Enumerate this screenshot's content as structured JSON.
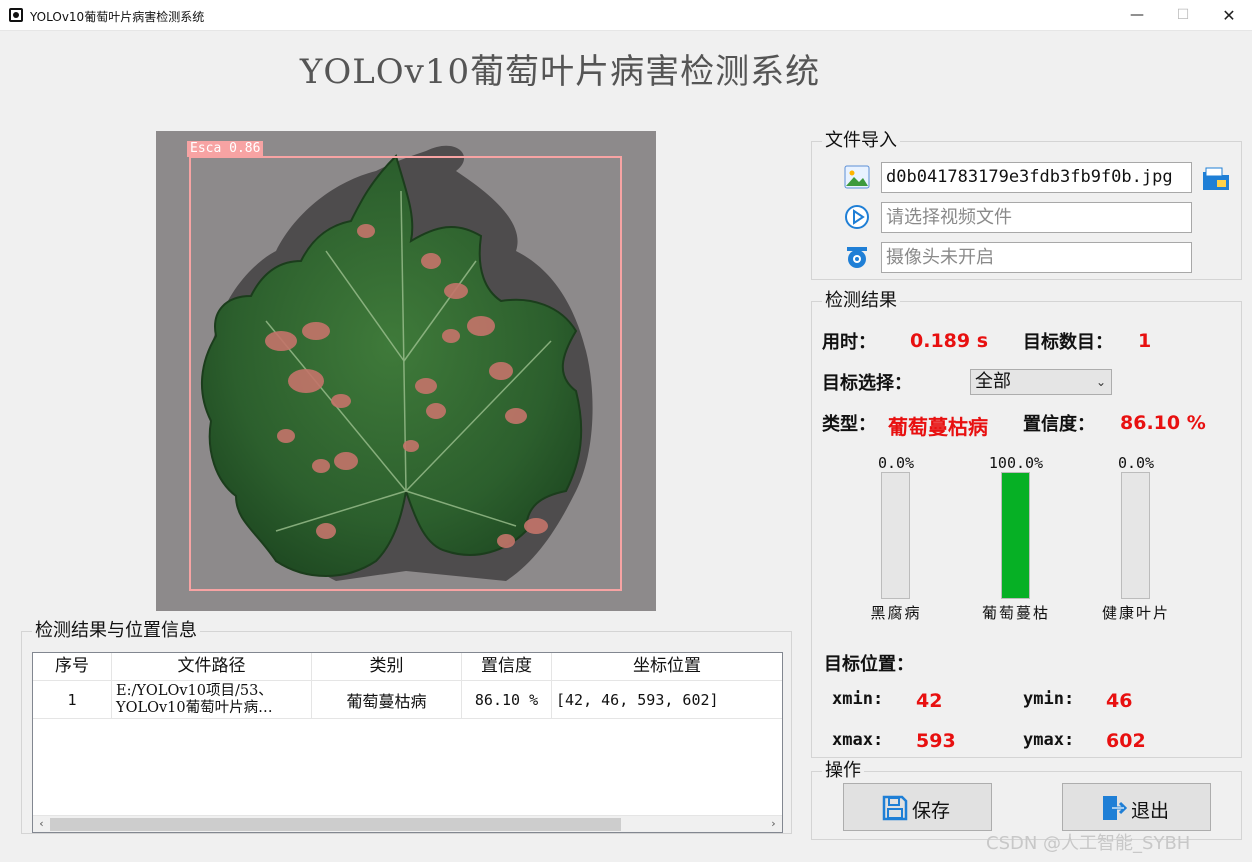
{
  "window": {
    "title": "YOLOv10葡萄叶片病害检测系统",
    "min": "—",
    "max": "☐",
    "close": "✕"
  },
  "app_title": "YOLOv10葡萄叶片病害检测系统",
  "detection_image": {
    "box_label": "Esca 0.86"
  },
  "file_import": {
    "title": "文件导入",
    "image_file": "d0b041783179e3fdb3fb9f0b.jpg",
    "video_placeholder": "请选择视频文件",
    "camera_status": "摄像头未开启"
  },
  "result": {
    "title": "检测结果",
    "time_label": "用时：",
    "time_value": "0.189 s",
    "count_label": "目标数目：",
    "count_value": "1",
    "select_label": "目标选择：",
    "select_value": "全部",
    "type_label": "类型：",
    "type_value": "葡萄蔓枯病",
    "conf_label": "置信度：",
    "conf_value": "86.10 %",
    "bars": [
      {
        "name": "黑腐病",
        "pct_text": "0.0%",
        "fraction": 0.0
      },
      {
        "name": "葡萄蔓枯",
        "pct_text": "100.0%",
        "fraction": 1.0
      },
      {
        "name": "健康叶片",
        "pct_text": "0.0%",
        "fraction": 0.0
      }
    ],
    "pos_title": "目标位置：",
    "xmin_label": "xmin:",
    "xmin": "42",
    "ymin_label": "ymin:",
    "ymin": "46",
    "xmax_label": "xmax:",
    "xmax": "593",
    "ymax_label": "ymax:",
    "ymax": "602"
  },
  "ops": {
    "title": "操作",
    "save": "保存",
    "exit": "退出"
  },
  "table": {
    "title": "检测结果与位置信息",
    "headers": [
      "序号",
      "文件路径",
      "类别",
      "置信度",
      "坐标位置"
    ],
    "rows": [
      {
        "idx": "1",
        "path_line1": "E:/YOLOv10项目/53、",
        "path_line2": "YOLOv10葡萄叶片病…",
        "cls": "葡萄蔓枯病",
        "conf": "86.10 %",
        "coords": "[42, 46, 593, 602]"
      }
    ]
  },
  "watermark": "CSDN @人工智能_SYBH",
  "colors": {
    "accent_red": "#e81010",
    "bar_fill": "#06b025",
    "bbox": "#f7a3a3"
  }
}
